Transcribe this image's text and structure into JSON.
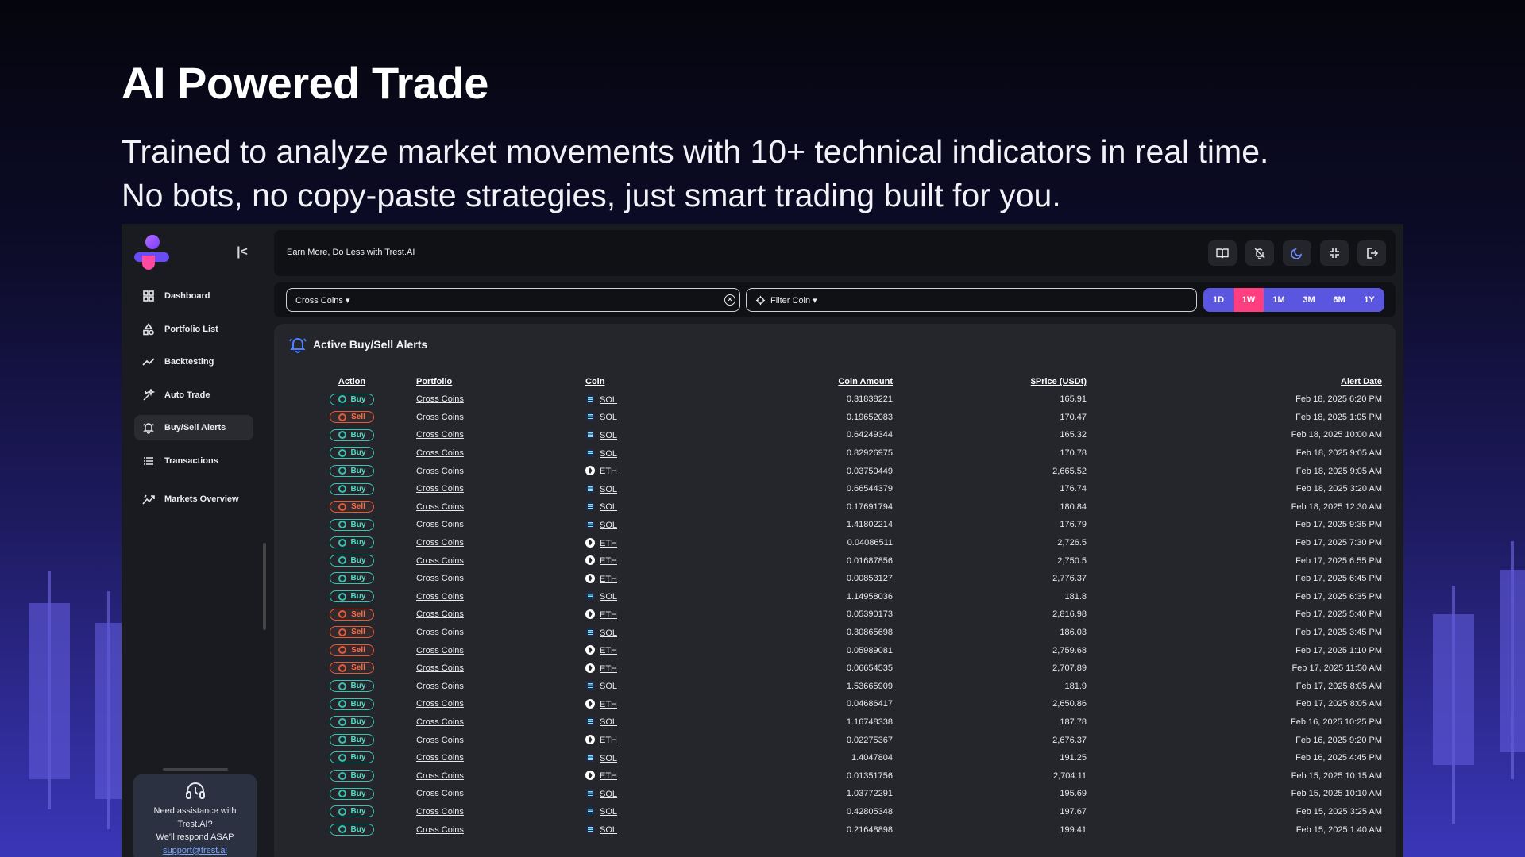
{
  "hero": {
    "title": "AI Powered Trade",
    "subtitle_line1": "Trained to analyze market movements with 10+ technical indicators in real time.",
    "subtitle_line2": "No bots, no copy-paste strategies, just smart trading built for you."
  },
  "sidebar": {
    "items": [
      {
        "label": "Dashboard",
        "icon": "dashboard-icon"
      },
      {
        "label": "Portfolio List",
        "icon": "shapes-icon"
      },
      {
        "label": "Backtesting",
        "icon": "trend-icon"
      },
      {
        "label": "Auto Trade",
        "icon": "sparkle-icon"
      },
      {
        "label": "Buy/Sell Alerts",
        "icon": "bell-icon"
      },
      {
        "label": "Transactions",
        "icon": "list-icon"
      },
      {
        "label": "Markets Overview",
        "icon": "chart-icon"
      }
    ],
    "help": {
      "line1": "Need assistance with",
      "line2": "Trest.AI?",
      "line3": "We'll respond ASAP",
      "email": "support@trest.ai"
    }
  },
  "topbar": {
    "brand": "Earn More, Do Less with Trest.AI"
  },
  "filters": {
    "portfolio": "Cross Coins ▾",
    "coin": "Filter Coin ▾",
    "ranges": [
      "1D",
      "1W",
      "1M",
      "3M",
      "6M",
      "1Y"
    ],
    "active_range": "1W"
  },
  "panel": {
    "title": "Active Buy/Sell Alerts",
    "columns": [
      "Action",
      "Portfolio",
      "Coin",
      "Coin Amount",
      "$Price (USDt)",
      "Alert Date"
    ]
  },
  "rows": [
    {
      "action": "Buy",
      "portfolio": "Cross Coins",
      "coin": "SOL",
      "amount": "0.31838221",
      "price": "165.91",
      "date": "Feb 18, 2025 6:20 PM"
    },
    {
      "action": "Sell",
      "portfolio": "Cross Coins",
      "coin": "SOL",
      "amount": "0.19652083",
      "price": "170.47",
      "date": "Feb 18, 2025 1:05 PM"
    },
    {
      "action": "Buy",
      "portfolio": "Cross Coins",
      "coin": "SOL",
      "amount": "0.64249344",
      "price": "165.32",
      "date": "Feb 18, 2025 10:00 AM"
    },
    {
      "action": "Buy",
      "portfolio": "Cross Coins",
      "coin": "SOL",
      "amount": "0.82926975",
      "price": "170.78",
      "date": "Feb 18, 2025 9:05 AM"
    },
    {
      "action": "Buy",
      "portfolio": "Cross Coins",
      "coin": "ETH",
      "amount": "0.03750449",
      "price": "2,665.52",
      "date": "Feb 18, 2025 9:05 AM"
    },
    {
      "action": "Buy",
      "portfolio": "Cross Coins",
      "coin": "SOL",
      "amount": "0.66544379",
      "price": "176.74",
      "date": "Feb 18, 2025 3:20 AM"
    },
    {
      "action": "Sell",
      "portfolio": "Cross Coins",
      "coin": "SOL",
      "amount": "0.17691794",
      "price": "180.84",
      "date": "Feb 18, 2025 12:30 AM"
    },
    {
      "action": "Buy",
      "portfolio": "Cross Coins",
      "coin": "SOL",
      "amount": "1.41802214",
      "price": "176.79",
      "date": "Feb 17, 2025 9:35 PM"
    },
    {
      "action": "Buy",
      "portfolio": "Cross Coins",
      "coin": "ETH",
      "amount": "0.04086511",
      "price": "2,726.5",
      "date": "Feb 17, 2025 7:30 PM"
    },
    {
      "action": "Buy",
      "portfolio": "Cross Coins",
      "coin": "ETH",
      "amount": "0.01687856",
      "price": "2,750.5",
      "date": "Feb 17, 2025 6:55 PM"
    },
    {
      "action": "Buy",
      "portfolio": "Cross Coins",
      "coin": "ETH",
      "amount": "0.00853127",
      "price": "2,776.37",
      "date": "Feb 17, 2025 6:45 PM"
    },
    {
      "action": "Buy",
      "portfolio": "Cross Coins",
      "coin": "SOL",
      "amount": "1.14958036",
      "price": "181.8",
      "date": "Feb 17, 2025 6:35 PM"
    },
    {
      "action": "Sell",
      "portfolio": "Cross Coins",
      "coin": "ETH",
      "amount": "0.05390173",
      "price": "2,816.98",
      "date": "Feb 17, 2025 5:40 PM"
    },
    {
      "action": "Sell",
      "portfolio": "Cross Coins",
      "coin": "SOL",
      "amount": "0.30865698",
      "price": "186.03",
      "date": "Feb 17, 2025 3:45 PM"
    },
    {
      "action": "Sell",
      "portfolio": "Cross Coins",
      "coin": "ETH",
      "amount": "0.05989081",
      "price": "2,759.68",
      "date": "Feb 17, 2025 1:10 PM"
    },
    {
      "action": "Sell",
      "portfolio": "Cross Coins",
      "coin": "ETH",
      "amount": "0.06654535",
      "price": "2,707.89",
      "date": "Feb 17, 2025 11:50 AM"
    },
    {
      "action": "Buy",
      "portfolio": "Cross Coins",
      "coin": "SOL",
      "amount": "1.53665909",
      "price": "181.9",
      "date": "Feb 17, 2025 8:05 AM"
    },
    {
      "action": "Buy",
      "portfolio": "Cross Coins",
      "coin": "ETH",
      "amount": "0.04686417",
      "price": "2,650.86",
      "date": "Feb 17, 2025 8:05 AM"
    },
    {
      "action": "Buy",
      "portfolio": "Cross Coins",
      "coin": "SOL",
      "amount": "1.16748338",
      "price": "187.78",
      "date": "Feb 16, 2025 10:25 PM"
    },
    {
      "action": "Buy",
      "portfolio": "Cross Coins",
      "coin": "ETH",
      "amount": "0.02275367",
      "price": "2,676.37",
      "date": "Feb 16, 2025 9:20 PM"
    },
    {
      "action": "Buy",
      "portfolio": "Cross Coins",
      "coin": "SOL",
      "amount": "1.4047804",
      "price": "191.25",
      "date": "Feb 16, 2025 4:45 PM"
    },
    {
      "action": "Buy",
      "portfolio": "Cross Coins",
      "coin": "ETH",
      "amount": "0.01351756",
      "price": "2,704.11",
      "date": "Feb 15, 2025 10:15 AM"
    },
    {
      "action": "Buy",
      "portfolio": "Cross Coins",
      "coin": "SOL",
      "amount": "1.03772291",
      "price": "195.69",
      "date": "Feb 15, 2025 10:10 AM"
    },
    {
      "action": "Buy",
      "portfolio": "Cross Coins",
      "coin": "SOL",
      "amount": "0.42805348",
      "price": "197.67",
      "date": "Feb 15, 2025 3:25 AM"
    },
    {
      "action": "Buy",
      "portfolio": "Cross Coins",
      "coin": "SOL",
      "amount": "0.21648898",
      "price": "199.41",
      "date": "Feb 15, 2025 1:40 AM"
    }
  ],
  "colors": {
    "accent": "#5b56e0",
    "active_range": "#ff3e80",
    "buy": "#3ac2b0",
    "sell": "#e45b3a"
  }
}
